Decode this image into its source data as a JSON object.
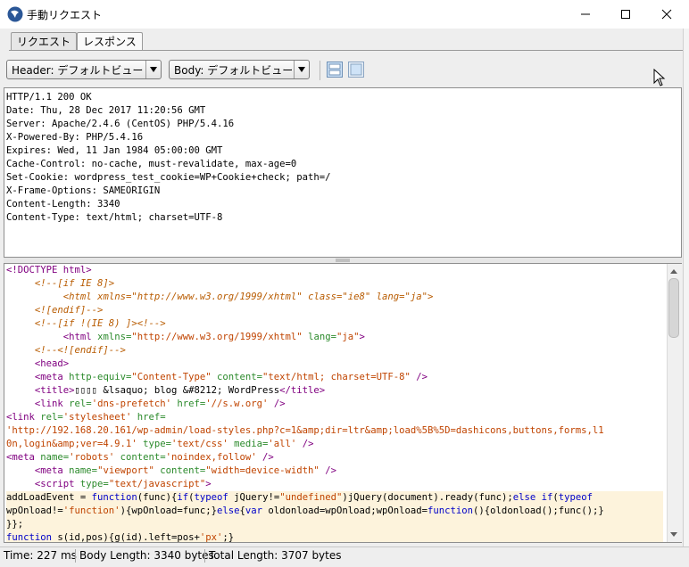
{
  "window": {
    "title": "手動リクエスト"
  },
  "tabs": [
    {
      "label": "リクエスト"
    },
    {
      "label": "レスポンス"
    }
  ],
  "toolbar": {
    "header_view": "Header: デフォルトビュー",
    "body_view": "Body: デフォルトビュー"
  },
  "response_headers": [
    "HTTP/1.1 200 OK",
    "Date: Thu, 28 Dec 2017 11:20:56 GMT",
    "Server: Apache/2.4.6 (CentOS) PHP/5.4.16",
    "X-Powered-By: PHP/5.4.16",
    "Expires: Wed, 11 Jan 1984 05:00:00 GMT",
    "Cache-Control: no-cache, must-revalidate, max-age=0",
    "Set-Cookie: wordpress_test_cookie=WP+Cookie+check; path=/",
    "X-Frame-Options: SAMEORIGIN",
    "Content-Length: 3340",
    "Content-Type: text/html; charset=UTF-8"
  ],
  "response_body": [
    {
      "hl": false,
      "parts": [
        [
          "tg",
          "<!DOCTYPE html>"
        ]
      ]
    },
    {
      "hl": false,
      "parts": [
        [
          "",
          "     "
        ],
        [
          "cm",
          "<!--[if IE 8]>"
        ]
      ]
    },
    {
      "hl": false,
      "parts": [
        [
          "",
          "          "
        ],
        [
          "cm",
          "<html "
        ],
        [
          "at2",
          "xmlns="
        ],
        [
          "vl2",
          "\"http://www.w3.org/1999/xhtml\""
        ],
        [
          "at2",
          " class="
        ],
        [
          "vl2",
          "\"ie8\""
        ],
        [
          "at2",
          " lang="
        ],
        [
          "vl2",
          "\"ja\""
        ],
        [
          "cm",
          ">"
        ]
      ]
    },
    {
      "hl": false,
      "parts": [
        [
          "",
          "     "
        ],
        [
          "cm",
          "<![endif]-->"
        ]
      ]
    },
    {
      "hl": false,
      "parts": [
        [
          "",
          "     "
        ],
        [
          "cm",
          "<!--[if !(IE 8) ]><!-->"
        ]
      ]
    },
    {
      "hl": false,
      "parts": [
        [
          "",
          "          "
        ],
        [
          "tg",
          "<html "
        ],
        [
          "at",
          "xmlns="
        ],
        [
          "vl",
          "\"http://www.w3.org/1999/xhtml\""
        ],
        [
          "at",
          " lang="
        ],
        [
          "vl",
          "\"ja\""
        ],
        [
          "tg",
          ">"
        ]
      ]
    },
    {
      "hl": false,
      "parts": [
        [
          "",
          "     "
        ],
        [
          "cm",
          "<!--<![endif]-->"
        ]
      ]
    },
    {
      "hl": false,
      "parts": [
        [
          "",
          "     "
        ],
        [
          "tg",
          "<head>"
        ]
      ]
    },
    {
      "hl": false,
      "parts": [
        [
          "",
          "     "
        ],
        [
          "tg",
          "<meta "
        ],
        [
          "at",
          "http-equiv="
        ],
        [
          "vl",
          "\"Content-Type\""
        ],
        [
          "at",
          " content="
        ],
        [
          "vl",
          "\"text/html; charset=UTF-8\""
        ],
        [
          "tg",
          " />"
        ]
      ]
    },
    {
      "hl": false,
      "parts": [
        [
          "",
          "     "
        ],
        [
          "tg",
          "<title>"
        ],
        [
          "",
          "▯▯▯▯ &lsaquo; blog &#8212; WordPress"
        ],
        [
          "tg",
          "</title>"
        ]
      ]
    },
    {
      "hl": false,
      "parts": [
        [
          "",
          "     "
        ],
        [
          "tg",
          "<link "
        ],
        [
          "at",
          "rel="
        ],
        [
          "vl",
          "'dns-prefetch'"
        ],
        [
          "at",
          " href="
        ],
        [
          "vl",
          "'//s.w.org'"
        ],
        [
          "tg",
          " />"
        ]
      ]
    },
    {
      "hl": false,
      "parts": [
        [
          "tg",
          "<link "
        ],
        [
          "at",
          "rel="
        ],
        [
          "vl",
          "'stylesheet'"
        ],
        [
          "at",
          " href="
        ]
      ]
    },
    {
      "hl": false,
      "parts": [
        [
          "vl",
          "'http://192.168.20.161/wp-admin/load-styles.php?c=1&amp;dir=ltr&amp;load%5B%5D=dashicons,buttons,forms,l1"
        ]
      ]
    },
    {
      "hl": false,
      "parts": [
        [
          "vl",
          "0n,login&amp;ver=4.9.1'"
        ],
        [
          "at",
          " type="
        ],
        [
          "vl",
          "'text/css'"
        ],
        [
          "at",
          " media="
        ],
        [
          "vl",
          "'all'"
        ],
        [
          "tg",
          " />"
        ]
      ]
    },
    {
      "hl": false,
      "parts": [
        [
          "tg",
          "<meta "
        ],
        [
          "at",
          "name="
        ],
        [
          "vl",
          "'robots'"
        ],
        [
          "at",
          " content="
        ],
        [
          "vl",
          "'noindex,follow'"
        ],
        [
          "tg",
          " />"
        ]
      ]
    },
    {
      "hl": false,
      "parts": [
        [
          "",
          "     "
        ],
        [
          "tg",
          "<meta "
        ],
        [
          "at",
          "name="
        ],
        [
          "vl",
          "\"viewport\""
        ],
        [
          "at",
          " content="
        ],
        [
          "vl",
          "\"width=device-width\""
        ],
        [
          "tg",
          " />"
        ]
      ]
    },
    {
      "hl": false,
      "parts": [
        [
          "",
          "     "
        ],
        [
          "tg",
          "<script "
        ],
        [
          "at",
          "type="
        ],
        [
          "vl",
          "\"text/javascript\""
        ],
        [
          "tg",
          ">"
        ]
      ]
    },
    {
      "hl": true,
      "parts": [
        [
          "",
          "addLoadEvent = "
        ],
        [
          "ky",
          "function"
        ],
        [
          "",
          "(func){"
        ],
        [
          "ky",
          "if"
        ],
        [
          "",
          "("
        ],
        [
          "ky",
          "typeof"
        ],
        [
          "",
          " jQuery!="
        ],
        [
          "vl",
          "\"undefined\""
        ],
        [
          "",
          ")jQuery(document).ready(func);"
        ],
        [
          "ky",
          "else if"
        ],
        [
          "",
          "("
        ],
        [
          "ky",
          "typeof"
        ]
      ]
    },
    {
      "hl": true,
      "parts": [
        [
          "",
          "wpOnload!="
        ],
        [
          "vl",
          "'function'"
        ],
        [
          "",
          "){wpOnload=func;}"
        ],
        [
          "ky",
          "else"
        ],
        [
          "",
          "{"
        ],
        [
          "ky",
          "var"
        ],
        [
          "",
          "",
          " oldonload=wpOnload;wpOnload="
        ],
        [
          "ky",
          "function"
        ],
        [
          "",
          "(){oldonload();func();}"
        ]
      ]
    },
    {
      "hl": true,
      "parts": [
        [
          "",
          "}};"
        ]
      ]
    },
    {
      "hl": true,
      "parts": [
        [
          "ky",
          "function"
        ],
        [
          "",
          "",
          " s(id,pos){g(id).left=pos+"
        ],
        [
          "vl",
          "'px'"
        ],
        [
          "",
          ";}"
        ]
      ]
    }
  ],
  "status": {
    "time": "Time: 227 ms",
    "body_length": "Body Length: 3340 bytes",
    "total_length": "Total Length: 3707 bytes"
  },
  "colors": {
    "accent": "#2b5797",
    "highlight": "#fdf3dc"
  }
}
